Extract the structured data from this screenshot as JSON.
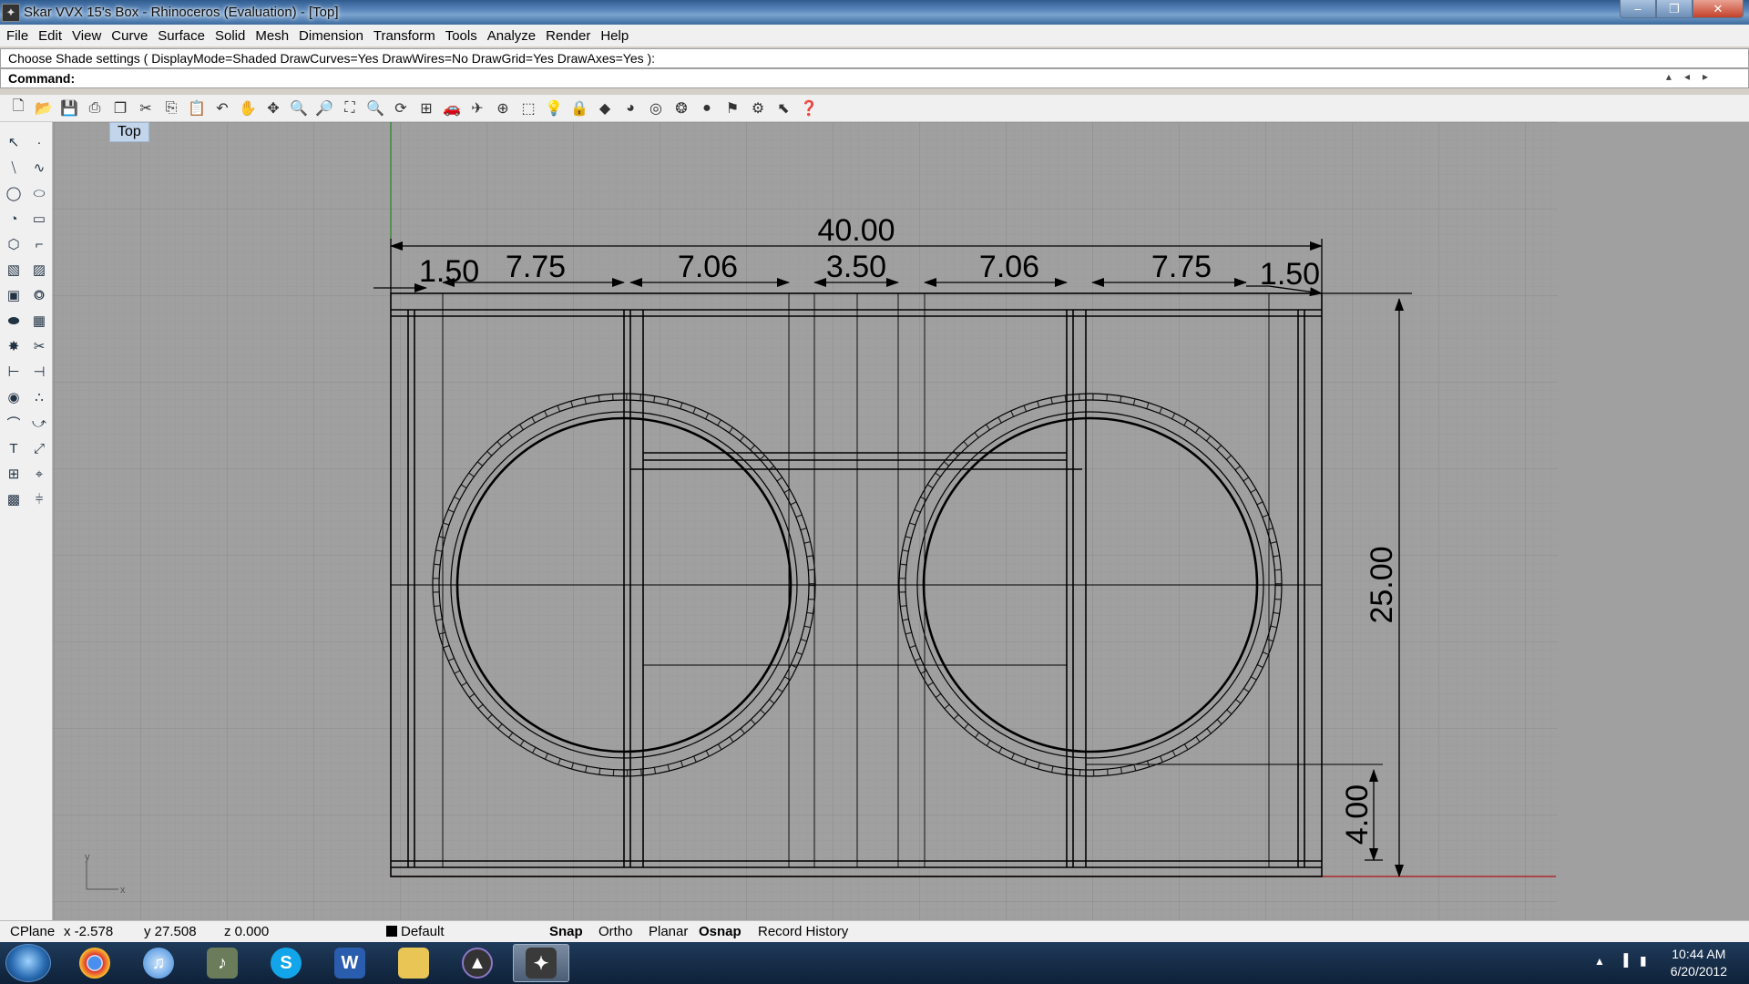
{
  "window": {
    "title": "Skar VVX 15's Box - Rhinoceros (Evaluation) - [Top]"
  },
  "menu": [
    "File",
    "Edit",
    "View",
    "Curve",
    "Surface",
    "Solid",
    "Mesh",
    "Dimension",
    "Transform",
    "Tools",
    "Analyze",
    "Render",
    "Help"
  ],
  "command": {
    "history": "Choose Shade settings ( DisplayMode=Shaded  DrawCurves=Yes  DrawWires=No  DrawGrid=Yes  DrawAxes=Yes ):",
    "prompt": "Command:"
  },
  "viewport": {
    "name": "Top",
    "dimensions": {
      "overall_width": "40.00",
      "segments": [
        "1.50",
        "7.75",
        "7.06",
        "3.50",
        "7.06",
        "7.75",
        "1.50"
      ],
      "height": "25.00",
      "port_height": "4.00"
    },
    "axis": {
      "x": "x",
      "y": "y"
    }
  },
  "status": {
    "cplane": "CPlane",
    "x": "x -2.578",
    "y": "y 27.508",
    "z": "z 0.000",
    "layer": "Default",
    "snap": "Snap",
    "ortho": "Ortho",
    "planar": "Planar",
    "osnap": "Osnap",
    "record_history": "Record History"
  },
  "taskbar": {
    "time": "10:44 AM",
    "date": "6/20/2012",
    "apps": [
      "chrome-icon",
      "itunes-icon",
      "music-icon",
      "skype-icon",
      "word-icon",
      "folder-icon",
      "avid-icon",
      "rhino-icon"
    ]
  },
  "colors": {
    "viewport_bg": "#a0a0a0",
    "grid_minor": "#979797",
    "grid_major": "#8a8a8a",
    "x_axis": "#b01010",
    "y_axis": "#108010"
  }
}
